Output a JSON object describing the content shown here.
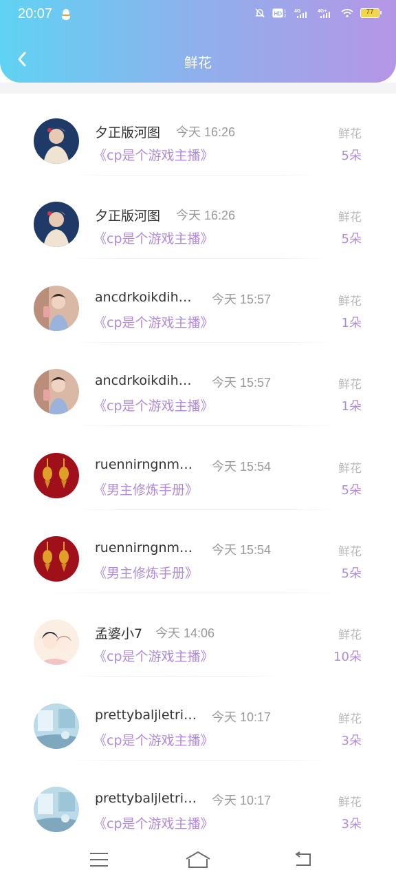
{
  "status_bar": {
    "time": "20:07",
    "battery": "77",
    "network_1": "4G",
    "network_2": "4G+",
    "hd_label": "HD"
  },
  "header": {
    "title": "鲜花",
    "back_icon": "chevron-left-icon"
  },
  "list": {
    "items": [
      {
        "username": "夕正版河图",
        "time": "今天 16:26",
        "book": "《cp是个游戏主播》",
        "gift_label": "鲜花",
        "gift_count": "5朵",
        "avatar": "woman-portrait"
      },
      {
        "username": "夕正版河图",
        "time": "今天 16:26",
        "book": "《cp是个游戏主播》",
        "gift_label": "鲜花",
        "gift_count": "5朵",
        "avatar": "woman-portrait"
      },
      {
        "username": "ancdrkoikdih…",
        "time": "今天 15:57",
        "book": "《cp是个游戏主播》",
        "gift_label": "鲜花",
        "gift_count": "1朵",
        "avatar": "girl-selfie"
      },
      {
        "username": "ancdrkoikdih…",
        "time": "今天 15:57",
        "book": "《cp是个游戏主播》",
        "gift_label": "鲜花",
        "gift_count": "1朵",
        "avatar": "girl-selfie"
      },
      {
        "username": "ruennirngnm…",
        "time": "今天 15:54",
        "book": "《男主修炼手册》",
        "gift_label": "鲜花",
        "gift_count": "5朵",
        "avatar": "red-lanterns"
      },
      {
        "username": "ruennirngnm…",
        "time": "今天 15:54",
        "book": "《男主修炼手册》",
        "gift_label": "鲜花",
        "gift_count": "5朵",
        "avatar": "red-lanterns"
      },
      {
        "username": "孟婆小7",
        "time": "今天 14:06",
        "book": "《cp是个游戏主播》",
        "gift_label": "鲜花",
        "gift_count": "10朵",
        "avatar": "anime-couple"
      },
      {
        "username": "prettybaljletri…",
        "time": "今天 10:17",
        "book": "《cp是个游戏主播》",
        "gift_label": "鲜花",
        "gift_count": "3朵",
        "avatar": "blue-room"
      },
      {
        "username": "prettybaljletri…",
        "time": "今天 10:17",
        "book": "《cp是个游戏主播》",
        "gift_label": "鲜花",
        "gift_count": "3朵",
        "avatar": "blue-room"
      }
    ]
  },
  "bottom_nav": {
    "menu_icon": "menu-icon",
    "home_icon": "home-icon",
    "back_icon": "return-icon"
  },
  "colors": {
    "header_start": "#5fd3f3",
    "header_end": "#b596e6",
    "accent_purple": "#b08adc",
    "text_gray": "#9a9a9a"
  }
}
